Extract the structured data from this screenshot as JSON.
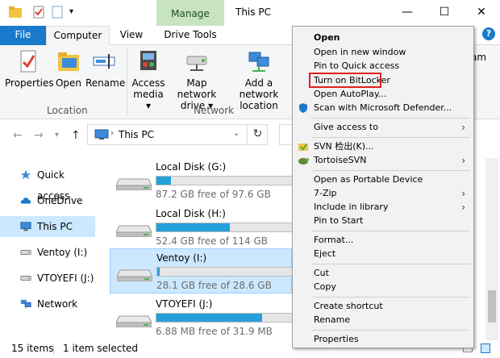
{
  "titlebar": {
    "manage_label": "Manage",
    "window_title": "This PC",
    "minimize": "—",
    "maximize": "☐",
    "close": "✕"
  },
  "tabs": {
    "file": "File",
    "computer": "Computer",
    "view": "View",
    "drive_tools": "Drive Tools"
  },
  "ribbon": {
    "properties": "Properties",
    "open": "Open",
    "rename": "Rename",
    "access_media_1": "Access",
    "access_media_2": "media ▾",
    "map_drive_1": "Map network",
    "map_drive_2": "drive ▾",
    "add_location_1": "Add a network",
    "add_location_2": "location",
    "group_location": "Location",
    "group_network": "Network",
    "partial_right": "am"
  },
  "address": {
    "path": "This PC",
    "refresh": "↻"
  },
  "navpane": {
    "items": [
      {
        "label": "Quick access",
        "icon": "star-icon"
      },
      {
        "label": "OneDrive",
        "icon": "cloud-icon"
      },
      {
        "label": "This PC",
        "icon": "computer-icon"
      },
      {
        "label": "Ventoy (I:)",
        "icon": "drive-icon"
      },
      {
        "label": "VTOYEFI (J:)",
        "icon": "drive-icon"
      },
      {
        "label": "Network",
        "icon": "network-icon"
      }
    ]
  },
  "drives": [
    {
      "name": "Local Disk (G:)",
      "free": "87.2 GB free of 97.6 GB",
      "used_fraction": 0.11
    },
    {
      "name": "Local Disk (H:)",
      "free": "52.4 GB free of 114 GB",
      "used_fraction": 0.54
    },
    {
      "name": "Ventoy (I:)",
      "free": "28.1 GB free of 28.6 GB",
      "used_fraction": 0.02
    },
    {
      "name": "VTOYEFI (J:)",
      "free": "6.88 MB free of 31.9 MB",
      "used_fraction": 0.78
    }
  ],
  "status": {
    "count": "15 items",
    "selected": "1 item selected"
  },
  "context_menu": {
    "open": "Open",
    "open_new_window": "Open in new window",
    "pin_quick_access": "Pin to Quick access",
    "bitlocker": "Turn on BitLocker",
    "autoplay": "Open AutoPlay...",
    "defender": "Scan with Microsoft Defender...",
    "give_access": "Give access to",
    "svn_checkout": "SVN 检出(K)...",
    "tortoisesvn": "TortoiseSVN",
    "portable_device": "Open as Portable Device",
    "sevenzip": "7-Zip",
    "include_library": "Include in library",
    "pin_start": "Pin to Start",
    "format": "Format...",
    "eject": "Eject",
    "cut": "Cut",
    "copy": "Copy",
    "create_shortcut": "Create shortcut",
    "rename": "Rename",
    "properties": "Properties"
  },
  "colors": {
    "accent": "#1979ca",
    "manage_bg": "#c7e4bf",
    "selection": "#cce8ff",
    "highlight_box": "#e0201e",
    "drive_fill": "#26a0da"
  }
}
